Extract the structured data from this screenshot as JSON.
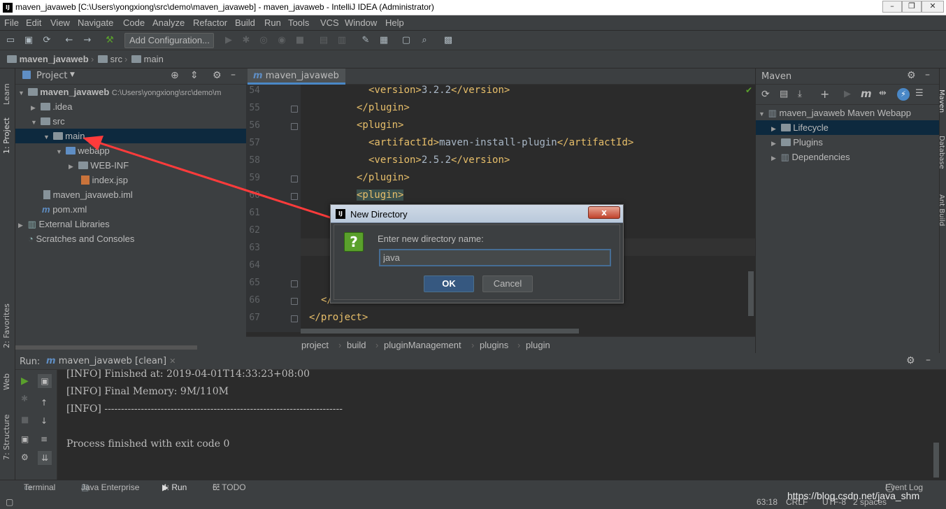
{
  "window": {
    "title": "maven_javaweb [C:\\Users\\yongxiong\\src\\demo\\maven_javaweb] - maven_javaweb - IntelliJ IDEA (Administrator)",
    "app_icon": "IJ"
  },
  "menu": [
    "File",
    "Edit",
    "View",
    "Navigate",
    "Code",
    "Analyze",
    "Refactor",
    "Build",
    "Run",
    "Tools",
    "VCS",
    "Window",
    "Help"
  ],
  "toolbar": {
    "add_config": "Add Configuration..."
  },
  "breadcrumb": [
    "maven_javaweb",
    "src",
    "main"
  ],
  "left_strip": {
    "learn": "Learn",
    "project": "1: Project",
    "favorites": "2: Favorites",
    "web": "Web",
    "structure": "7: Structure"
  },
  "project": {
    "header": "Project",
    "tree": [
      {
        "label": "maven_javaweb",
        "path": "C:\\Users\\yongxiong\\src\\demo\\m"
      },
      {
        "label": ".idea"
      },
      {
        "label": "src"
      },
      {
        "label": "main"
      },
      {
        "label": "webapp"
      },
      {
        "label": "WEB-INF"
      },
      {
        "label": "index.jsp"
      },
      {
        "label": "maven_javaweb.iml"
      },
      {
        "label": "pom.xml"
      },
      {
        "label": "External Libraries"
      },
      {
        "label": "Scratches and Consoles"
      }
    ]
  },
  "editor": {
    "tab": "maven_javaweb",
    "lines": [
      {
        "n": "54",
        "open": "<version>",
        "text": "3.2.2",
        "close": "</version>"
      },
      {
        "n": "55",
        "open": "</plugin>",
        "text": "",
        "close": ""
      },
      {
        "n": "56",
        "open": "<plugin>",
        "text": "",
        "close": ""
      },
      {
        "n": "57",
        "open": "<artifactId>",
        "text": "maven-install-plugin",
        "close": "</artifactId>"
      },
      {
        "n": "58",
        "open": "<version>",
        "text": "2.5.2",
        "close": "</version>"
      },
      {
        "n": "59",
        "open": "</plugin>",
        "text": "",
        "close": ""
      },
      {
        "n": "60",
        "open": "<plugin>",
        "text": "",
        "close": ""
      },
      {
        "n": "61",
        "open": "",
        "text": "",
        "close": ""
      },
      {
        "n": "62",
        "open": "",
        "text": "",
        "close": ""
      },
      {
        "n": "63",
        "open": "",
        "text": "",
        "close": ""
      },
      {
        "n": "64",
        "open": "",
        "text": "",
        "close": ""
      },
      {
        "n": "65",
        "open": "</",
        "text": "",
        "close": ""
      },
      {
        "n": "66",
        "open": "</bu",
        "text": "",
        "close": ""
      },
      {
        "n": "67",
        "open": "</project>",
        "text": "",
        "close": ""
      }
    ],
    "breadcrumb": [
      "project",
      "build",
      "pluginManagement",
      "plugins",
      "plugin"
    ]
  },
  "maven": {
    "header": "Maven",
    "root": "maven_javaweb Maven Webapp",
    "items": [
      "Lifecycle",
      "Plugins",
      "Dependencies"
    ],
    "m_icon": "m"
  },
  "right_strip": {
    "maven": "Maven",
    "database": "Database",
    "ant": "Ant Build"
  },
  "run": {
    "label": "Run:",
    "tab": "maven_javaweb [clean]",
    "lines": [
      "[INFO] Finished at: 2019-04-01T14:33:23+08:00",
      "[INFO] Final Memory: 9M/110M",
      "[INFO] ------------------------------------------------------------------------",
      "",
      "Process finished with exit code 0"
    ]
  },
  "bottom_tabs": {
    "terminal": "Terminal",
    "java_enterprise": "Java Enterprise",
    "run": "4: Run",
    "todo": "6: TODO",
    "event_log": "Event Log"
  },
  "status": {
    "position": "63:18",
    "line_sep": "CRLF",
    "encoding": "UTF-8",
    "indent": "2 spaces",
    "watermark": "https://blog.csdn.net/java_shm"
  },
  "dialog": {
    "title": "New Directory",
    "prompt": "Enter new directory name:",
    "value": "java",
    "ok": "OK",
    "cancel": "Cancel",
    "close_symbol": "x",
    "question": "?"
  },
  "colors": {
    "accent": "#4a88c7",
    "annotation_arrow": "#ff3b3b",
    "selection": "#0d293e"
  }
}
